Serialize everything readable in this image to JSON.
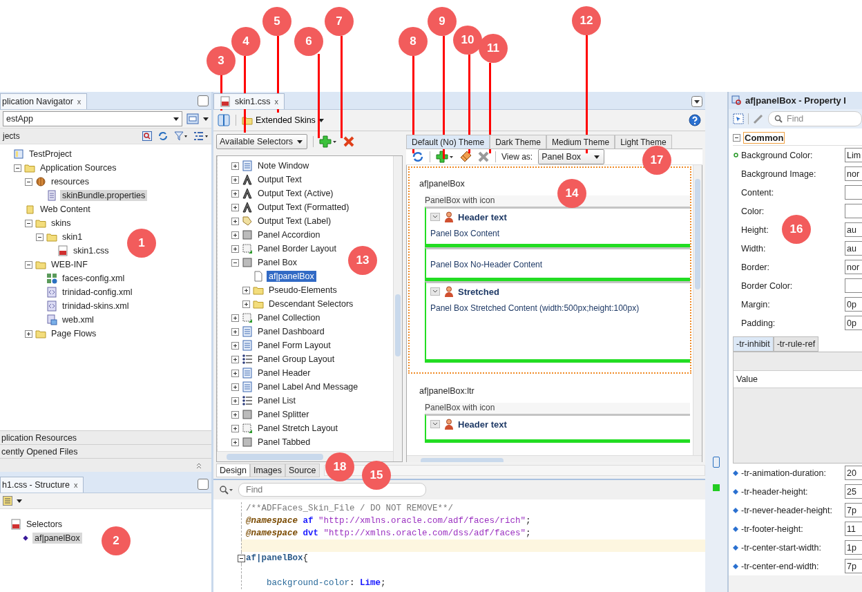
{
  "callouts": [
    {
      "label": "1"
    },
    {
      "label": "2"
    },
    {
      "label": "3"
    },
    {
      "label": "4"
    },
    {
      "label": "5"
    },
    {
      "label": "6"
    },
    {
      "label": "7"
    },
    {
      "label": "8"
    },
    {
      "label": "9"
    },
    {
      "label": "10"
    },
    {
      "label": "11"
    },
    {
      "label": "12"
    },
    {
      "label": "13"
    },
    {
      "label": "14"
    },
    {
      "label": "15"
    },
    {
      "label": "16"
    },
    {
      "label": "17"
    },
    {
      "label": "18"
    }
  ],
  "navigator": {
    "title": "plication Navigator",
    "close": "x",
    "app": "estApp",
    "section": "jects",
    "tree": [
      {
        "label": "TestProject",
        "kind": "project",
        "selected": false,
        "children": [
          {
            "label": "Application Sources",
            "kind": "folder",
            "expanded": true,
            "selected": false,
            "children": [
              {
                "label": "resources",
                "kind": "package",
                "expanded": true,
                "selected": false,
                "children": [
                  {
                    "label": "skinBundle.properties",
                    "kind": "file",
                    "selected": true
                  }
                ]
              }
            ]
          },
          {
            "label": "Web Content",
            "kind": "webfolder",
            "selected": false,
            "children": [
              {
                "label": "skins",
                "kind": "folder",
                "expanded": true,
                "selected": false,
                "children": [
                  {
                    "label": "skin1",
                    "kind": "folder",
                    "expanded": true,
                    "selected": false,
                    "children": [
                      {
                        "label": "skin1.css",
                        "kind": "css",
                        "selected": false
                      }
                    ]
                  }
                ]
              },
              {
                "label": "WEB-INF",
                "kind": "folder",
                "expanded": true,
                "selected": false,
                "children": [
                  {
                    "label": "faces-config.xml",
                    "kind": "config",
                    "selected": false
                  },
                  {
                    "label": "trinidad-config.xml",
                    "kind": "xml",
                    "selected": false
                  },
                  {
                    "label": "trinidad-skins.xml",
                    "kind": "xml",
                    "selected": false
                  },
                  {
                    "label": "web.xml",
                    "kind": "webxml",
                    "selected": false
                  }
                ]
              },
              {
                "label": "Page Flows",
                "kind": "folder",
                "expanded": false,
                "selected": false
              }
            ]
          }
        ]
      }
    ],
    "accordion": [
      "plication Resources",
      "cently Opened Files"
    ]
  },
  "structure": {
    "title": "h1.css - Structure",
    "close": "x",
    "tree": [
      {
        "label": "Selectors",
        "kind": "css",
        "selected": false,
        "children": [
          {
            "label": "af|panelBox",
            "kind": "diamond",
            "selected": true
          }
        ]
      }
    ]
  },
  "editor": {
    "tab": "skin1.css",
    "close": "x",
    "extended_skins": "Extended Skins",
    "selectors_dropdown": "Available Selectors",
    "selector_tree": [
      {
        "label": "Note Window",
        "kind": "component",
        "expanded": false,
        "selected": false
      },
      {
        "label": "Output Text",
        "kind": "text",
        "expanded": false,
        "selected": false
      },
      {
        "label": "Output Text (Active)",
        "kind": "text",
        "expanded": false,
        "selected": false
      },
      {
        "label": "Output Text (Formatted)",
        "kind": "text",
        "expanded": false,
        "selected": false
      },
      {
        "label": "Output Text (Label)",
        "kind": "tag",
        "expanded": false,
        "selected": false
      },
      {
        "label": "Panel Accordion",
        "kind": "panel",
        "expanded": false,
        "selected": false
      },
      {
        "label": "Panel Border Layout",
        "kind": "layout",
        "expanded": false,
        "selected": false
      },
      {
        "label": "Panel Box",
        "kind": "panel",
        "expanded": true,
        "selected": false,
        "children": [
          {
            "label": "af|panelBox",
            "kind": "page",
            "selected": true
          },
          {
            "label": "Pseudo-Elements",
            "kind": "folder",
            "expanded": false,
            "selected": false
          },
          {
            "label": "Descendant Selectors",
            "kind": "folder",
            "expanded": false,
            "selected": false
          }
        ]
      },
      {
        "label": "Panel Collection",
        "kind": "layout",
        "expanded": false,
        "selected": false
      },
      {
        "label": "Panel Dashboard",
        "kind": "component",
        "expanded": false,
        "selected": false
      },
      {
        "label": "Panel Form Layout",
        "kind": "component",
        "expanded": false,
        "selected": false
      },
      {
        "label": "Panel Group Layout",
        "kind": "list",
        "expanded": false,
        "selected": false
      },
      {
        "label": "Panel Header",
        "kind": "component",
        "expanded": false,
        "selected": false
      },
      {
        "label": "Panel Label And Message",
        "kind": "component",
        "expanded": false,
        "selected": false
      },
      {
        "label": "Panel List",
        "kind": "list",
        "expanded": false,
        "selected": false
      },
      {
        "label": "Panel Splitter",
        "kind": "panel",
        "expanded": false,
        "selected": false
      },
      {
        "label": "Panel Stretch Layout",
        "kind": "layout",
        "expanded": false,
        "selected": false
      },
      {
        "label": "Panel Tabbed",
        "kind": "panel",
        "expanded": false,
        "selected": false
      }
    ],
    "themes": [
      {
        "label": "Default (No) Theme",
        "selected": true
      },
      {
        "label": "Dark Theme",
        "selected": false
      },
      {
        "label": "Medium Theme",
        "selected": false
      },
      {
        "label": "Light Theme",
        "selected": false
      }
    ],
    "view_as_label": "View as:",
    "view_as": "Panel Box",
    "preview": [
      {
        "selector": "af|panelBox",
        "highlighted": true,
        "caption": "PanelBox with icon",
        "boxes": [
          {
            "kind": "header",
            "header": "Header text",
            "content": "Panel Box Content"
          },
          {
            "kind": "plain",
            "content": "Panel Box No-Header Content"
          },
          {
            "kind": "stretched",
            "header": "Stretched",
            "content": "Panel Box Stretched Content (width:500px;height:100px)"
          }
        ]
      },
      {
        "selector": "af|panelBox:ltr",
        "highlighted": false,
        "caption": "PanelBox with icon",
        "boxes": [
          {
            "kind": "header",
            "header": "Header text"
          }
        ]
      }
    ],
    "bottom_tabs": [
      {
        "label": "Design",
        "selected": true
      },
      {
        "label": "Images",
        "selected": false
      },
      {
        "label": "Source",
        "selected": false
      }
    ],
    "find_placeholder": "Find",
    "code": [
      {
        "current": false,
        "tokens": [
          {
            "kind": "comment",
            "text": "/**ADFFaces_Skin_File / DO NOT REMOVE**/"
          }
        ]
      },
      {
        "current": false,
        "tokens": [
          {
            "kind": "at",
            "text": "@namespace"
          },
          {
            "kind": "keyword",
            "text": " af"
          },
          {
            "kind": "string",
            "text": " \"http://xmlns.oracle.com/adf/faces/rich\""
          },
          {
            "kind": "plain",
            "text": ";"
          }
        ]
      },
      {
        "current": false,
        "tokens": [
          {
            "kind": "at",
            "text": "@namespace"
          },
          {
            "kind": "keyword",
            "text": " dvt"
          },
          {
            "kind": "string",
            "text": " \"http://xmlns.oracle.com/dss/adf/faces\""
          },
          {
            "kind": "plain",
            "text": ";"
          }
        ]
      },
      {
        "current": true
      },
      {
        "current": false,
        "expanded": true,
        "tokens": [
          {
            "kind": "selector",
            "text": "af|panelBox"
          },
          {
            "kind": "plain",
            "text": "{"
          }
        ]
      },
      {
        "current": false
      },
      {
        "current": false,
        "tokens": [
          {
            "kind": "property",
            "text": "    background-color"
          },
          {
            "kind": "plain",
            "text": ": "
          },
          {
            "kind": "keyword",
            "text": "Lime"
          },
          {
            "kind": "plain",
            "text": ";"
          }
        ]
      }
    ]
  },
  "inspector": {
    "title": "af|panelBox - Property I",
    "find_placeholder": "Find",
    "section": "Common",
    "section_expanded": true,
    "properties": [
      {
        "label": "Background Color:",
        "value": "Lim",
        "modified": true
      },
      {
        "label": "Background Image:",
        "value": "nor",
        "modified": false
      },
      {
        "label": "Content:",
        "modified": false
      },
      {
        "label": "Color:",
        "modified": false
      },
      {
        "label": "Height:",
        "value": "au",
        "modified": false
      },
      {
        "label": "Width:",
        "value": "au",
        "modified": false
      },
      {
        "label": "Border:",
        "value": "nor",
        "modified": false
      },
      {
        "label": "Border Color:",
        "modified": false
      },
      {
        "label": "Margin:",
        "value": "0p",
        "modified": false
      },
      {
        "label": "Padding:",
        "value": "0p",
        "modified": false
      }
    ],
    "tabs": [
      {
        "label": "-tr-inhibit",
        "selected": true
      },
      {
        "label": "-tr-rule-ref",
        "selected": false
      }
    ],
    "table_header": "Value",
    "tr_properties": [
      {
        "label": "-tr-animation-duration:",
        "value": "20"
      },
      {
        "label": "-tr-header-height:",
        "value": "25"
      },
      {
        "label": "-tr-never-header-height:",
        "value": "7p"
      },
      {
        "label": "-tr-footer-height:",
        "value": "11"
      },
      {
        "label": "-tr-center-start-width:",
        "value": "1p"
      },
      {
        "label": "-tr-center-end-width:",
        "value": "7p"
      }
    ]
  }
}
